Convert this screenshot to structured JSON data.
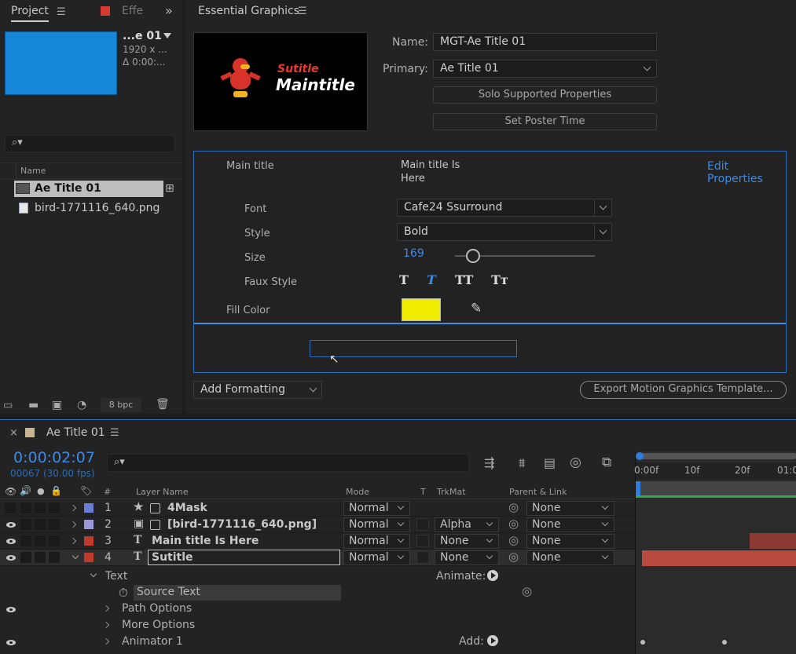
{
  "project": {
    "tab": "Project",
    "effects_tab": "Effe",
    "comp_name": "...e 01",
    "comp_size": "1920 x ...",
    "comp_duration": "Δ 0:00:...",
    "name_col": "Name",
    "items": [
      {
        "name": "Ae Title 01"
      },
      {
        "name": "bird-1771116_640.png"
      }
    ],
    "bpc": "8 bpc"
  },
  "eg": {
    "tab": "Essential Graphics",
    "name_label": "Name:",
    "name_value": "MGT-Ae Title 01",
    "primary_label": "Primary:",
    "primary_value": "Ae Title 01",
    "solo_button": "Solo Supported Properties",
    "poster_button": "Set Poster Time",
    "thumb_small": "Sutitle",
    "thumb_large": "Maintitle",
    "main_title_label": "Main title",
    "main_title_value_line1": "Main title Is",
    "main_title_value_line2": "Here",
    "edit_properties": "Edit Properties",
    "font_label": "Font",
    "font_value": "Cafe24 Ssurround",
    "style_label": "Style",
    "style_value": "Bold",
    "size_label": "Size",
    "size_value": "169",
    "size_fraction": 0.13,
    "faux_label": "Faux Style",
    "faux_glyphs": [
      "T",
      "T",
      "TT",
      "Tт"
    ],
    "fill_label": "Fill Color",
    "fill_color": "#f0ec00",
    "add_formatting": "Add Formatting",
    "export_button": "Export Motion Graphics Template..."
  },
  "timeline": {
    "close": "×",
    "tab": "Ae Title 01",
    "timecode": "0:00:02:07",
    "frames": "00067 (30.00 fps)",
    "columns": {
      "num": "#",
      "layer_name": "Layer Name",
      "mode": "Mode",
      "t": "T",
      "trkmat": "TrkMat",
      "parent": "Parent & Link"
    },
    "ruler": [
      "0:00f",
      "10f",
      "20f",
      "01:0"
    ],
    "layers": [
      {
        "num": "1",
        "name": "4Mask",
        "mode": "Normal",
        "trkmat": "",
        "parent": "None",
        "color": "#6a7ed6",
        "type": "star"
      },
      {
        "num": "2",
        "name": "[bird-1771116_640.png]",
        "mode": "Normal",
        "trkmat": "Alpha",
        "parent": "None",
        "color": "#9a98d6",
        "type": "image"
      },
      {
        "num": "3",
        "name": "Main title Is Here",
        "mode": "Normal",
        "trkmat": "None",
        "parent": "None",
        "color": "#c03a30",
        "type": "text"
      },
      {
        "num": "4",
        "name": "Sutitle",
        "mode": "Normal",
        "trkmat": "None",
        "parent": "None",
        "color": "#c03a30",
        "type": "text"
      }
    ],
    "sub": {
      "text": "Text",
      "animate": "Animate:",
      "source_text": "Source Text",
      "path_options": "Path Options",
      "more_options": "More Options",
      "animator": "Animator 1",
      "add": "Add:"
    }
  }
}
